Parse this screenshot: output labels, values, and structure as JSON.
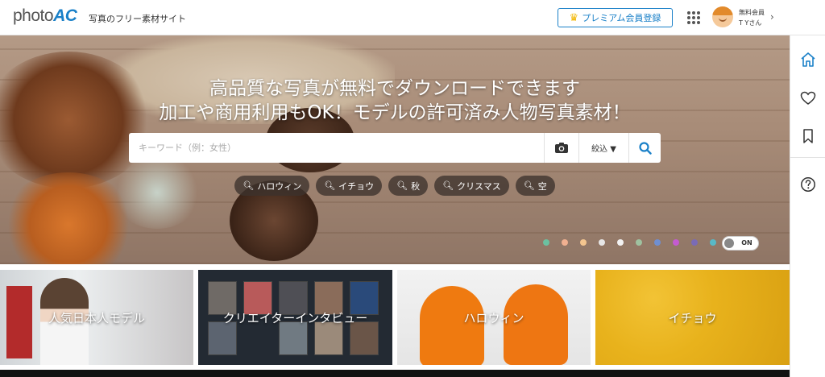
{
  "header": {
    "logo_photo": "photo",
    "logo_ac": "AC",
    "tagline": "写真のフリー素材サイト",
    "premium_button": "プレミアム会員登録",
    "user_plan": "無料会員",
    "user_name": "T Yさん",
    "icons": [
      "crown-icon",
      "apps-grid-icon",
      "avatar",
      "chevron-right-icon"
    ]
  },
  "hero": {
    "title_line1": "高品質な写真が無料でダウンロードできます",
    "title_line2": "加工や商用利用もOK！モデルの許可済み人物写真素材！",
    "search": {
      "placeholder": "キーワード（例：女性）",
      "value": "",
      "filter_label": "絞込 ▼"
    },
    "tags": [
      "ハロウィン",
      "イチョウ",
      "秋",
      "クリスマス",
      "空"
    ],
    "color_dots": [
      "#6cc0a0",
      "#f0b090",
      "#f3c58f",
      "#e6e6e6",
      "#f2f2f2",
      "#9fc2a0",
      "#6f8fd1",
      "#c45bd0",
      "#7a6bb5",
      "#58b9c7"
    ],
    "toggle_label": "ON"
  },
  "right_bar": {
    "icons": [
      "home-icon",
      "heart-icon",
      "bookmark-icon",
      "help-icon"
    ],
    "accent_color": "#1a80c8"
  },
  "categories": [
    {
      "label": "人気日本人モデル"
    },
    {
      "label": "クリエイターインタビュー"
    },
    {
      "label": "ハロウィン"
    },
    {
      "label": "イチョウ"
    }
  ],
  "colors": {
    "brand": "#1a80c8",
    "premium_crown": "#f2b600"
  }
}
